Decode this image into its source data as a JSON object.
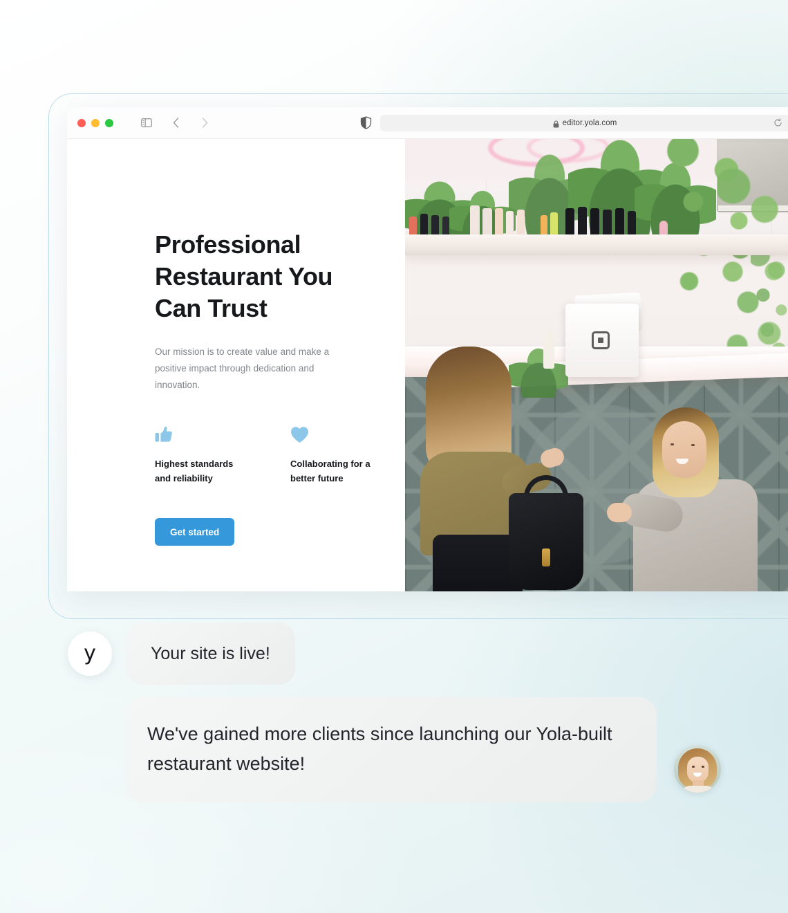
{
  "browser": {
    "window_controls": [
      "close",
      "minimize",
      "zoom"
    ],
    "sidebar_icon": "sidebar-toggle-icon",
    "back_icon": "chevron-left-icon",
    "forward_icon": "chevron-right-icon",
    "shield_icon": "shield-icon",
    "lock_icon": "lock-icon",
    "reload_icon": "reload-icon",
    "url": "editor.yola.com"
  },
  "site": {
    "hero": {
      "title": "Professional Restaurant You Can Trust",
      "subtitle": "Our mission is to create value and make a positive impact through dedication and innovation.",
      "cta_label": "Get started",
      "cta_color": "#3498db",
      "features": [
        {
          "icon": "thumbs-up-icon",
          "label": "Highest standards and reliability"
        },
        {
          "icon": "heart-icon",
          "label": "Collaborating for a better future"
        }
      ],
      "feature_icon_color": "#8cc7ea"
    },
    "photo_alt": "Two women at a salon counter with plants and a point-of-sale terminal"
  },
  "chat": {
    "messages": [
      {
        "avatar": "yola-logo-avatar",
        "avatar_glyph": "y",
        "text": "Your site is live!"
      },
      {
        "avatar": "user-photo-avatar",
        "text": "We've gained more clients since launching our Yola-built restaurant website!"
      }
    ]
  },
  "theme": {
    "background_top": "#ffffff",
    "background_bottom": "#e3f0f2",
    "frame_border": "#bdddec",
    "bubble_bg": "#eceeee"
  }
}
